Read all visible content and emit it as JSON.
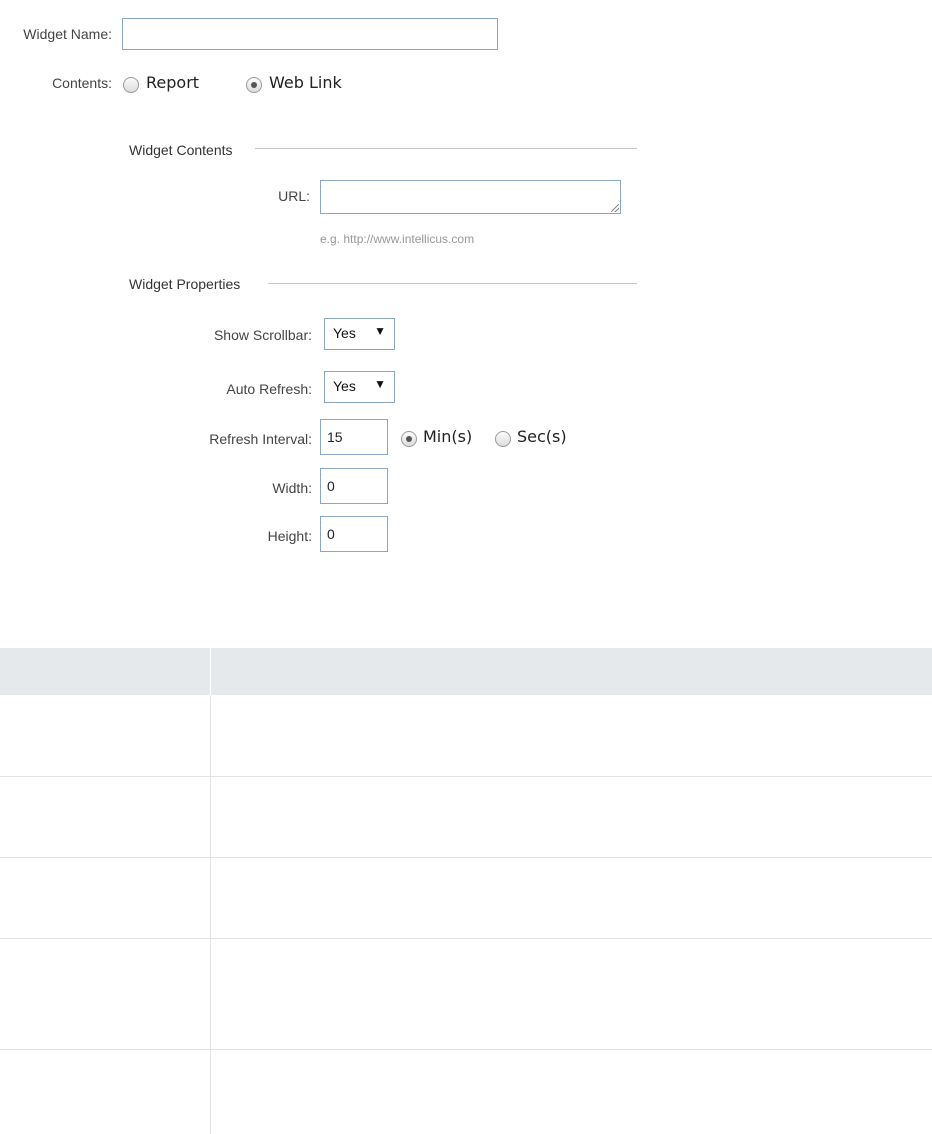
{
  "form": {
    "widget_name_label": "Widget Name:",
    "widget_name_value": "",
    "contents_label": "Contents:",
    "contents_options": [
      {
        "label": "Report",
        "checked": false
      },
      {
        "label": "Web Link",
        "checked": true
      }
    ]
  },
  "widget_contents": {
    "title": "Widget Contents",
    "url_label": "URL:",
    "url_value": "",
    "url_hint": "e.g. http://www.intellicus.com"
  },
  "widget_properties": {
    "title": "Widget Properties",
    "show_scrollbar_label": "Show Scrollbar:",
    "show_scrollbar_value": "Yes",
    "auto_refresh_label": "Auto Refresh:",
    "auto_refresh_value": "Yes",
    "refresh_interval_label": "Refresh Interval:",
    "refresh_interval_value": "15",
    "interval_units": [
      {
        "label": "Min(s)",
        "checked": true
      },
      {
        "label": "Sec(s)",
        "checked": false
      }
    ],
    "width_label": "Width:",
    "width_value": "0",
    "height_label": "Height:",
    "height_value": "0"
  },
  "table": {
    "row_count": 5
  }
}
